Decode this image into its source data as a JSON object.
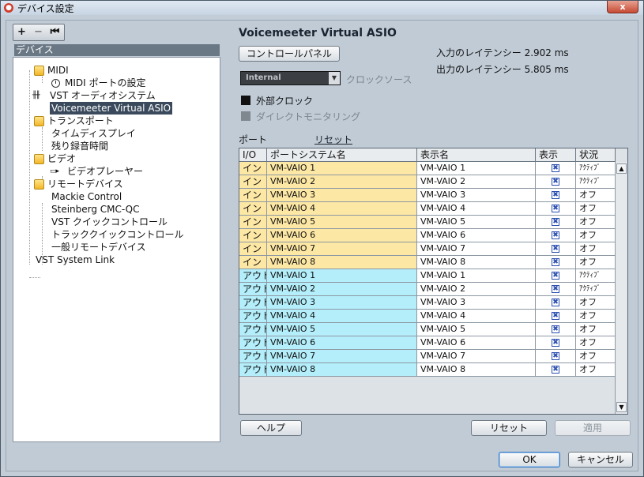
{
  "window": {
    "title": "デバイス設定",
    "close_label": "x"
  },
  "toolbar": {
    "add": "+",
    "remove": "−",
    "reset": "⏮"
  },
  "tree": {
    "header": "デバイス",
    "items": [
      {
        "label": "MIDI"
      },
      {
        "label": "MIDI ポートの設定"
      },
      {
        "label": "VST オーディオシステム"
      },
      {
        "label": "Voicemeeter Virtual ASIO"
      },
      {
        "label": "トランスポート"
      },
      {
        "label": "タイムディスプレイ"
      },
      {
        "label": "残り録音時間"
      },
      {
        "label": "ビデオ"
      },
      {
        "label": "ビデオプレーヤー"
      },
      {
        "label": "リモートデバイス"
      },
      {
        "label": "Mackie Control"
      },
      {
        "label": "Steinberg CMC-QC"
      },
      {
        "label": "VST クイックコントロール"
      },
      {
        "label": "トラッククイックコントロール"
      },
      {
        "label": "一般リモートデバイス"
      },
      {
        "label": "VST System Link"
      }
    ]
  },
  "panel": {
    "title": "Voicemeeter Virtual ASIO",
    "control_panel_button": "コントロールパネル",
    "input_latency": "入力のレイテンシー 2.902 ms",
    "output_latency": "出力のレイテンシー 5.805 ms",
    "clock_source_value": "Internal",
    "clock_source_label": "クロックソース",
    "external_clock_label": "外部クロック",
    "direct_monitoring_label": "ダイレクトモニタリング",
    "ports_label": "ポート",
    "reset_link": "リセット"
  },
  "table": {
    "columns": [
      "I/O",
      "ポートシステム名",
      "表示名",
      "表示",
      "状況"
    ],
    "rows": [
      {
        "io": "イン",
        "system": "VM-VAIO 1",
        "display": "VM-VAIO 1",
        "visible": "✖",
        "status": "ｱｸﾃｨﾌﾞ"
      },
      {
        "io": "イン",
        "system": "VM-VAIO 2",
        "display": "VM-VAIO 2",
        "visible": "✖",
        "status": "ｱｸﾃｨﾌﾞ"
      },
      {
        "io": "イン",
        "system": "VM-VAIO 3",
        "display": "VM-VAIO 3",
        "visible": "✖",
        "status": "オフ"
      },
      {
        "io": "イン",
        "system": "VM-VAIO 4",
        "display": "VM-VAIO 4",
        "visible": "✖",
        "status": "オフ"
      },
      {
        "io": "イン",
        "system": "VM-VAIO 5",
        "display": "VM-VAIO 5",
        "visible": "✖",
        "status": "オフ"
      },
      {
        "io": "イン",
        "system": "VM-VAIO 6",
        "display": "VM-VAIO 6",
        "visible": "✖",
        "status": "オフ"
      },
      {
        "io": "イン",
        "system": "VM-VAIO 7",
        "display": "VM-VAIO 7",
        "visible": "✖",
        "status": "オフ"
      },
      {
        "io": "イン",
        "system": "VM-VAIO 8",
        "display": "VM-VAIO 8",
        "visible": "✖",
        "status": "オフ"
      },
      {
        "io": "アウト",
        "system": "VM-VAIO 1",
        "display": "VM-VAIO 1",
        "visible": "✖",
        "status": "ｱｸﾃｨﾌﾞ"
      },
      {
        "io": "アウト",
        "system": "VM-VAIO 2",
        "display": "VM-VAIO 2",
        "visible": "✖",
        "status": "ｱｸﾃｨﾌﾞ"
      },
      {
        "io": "アウト",
        "system": "VM-VAIO 3",
        "display": "VM-VAIO 3",
        "visible": "✖",
        "status": "オフ"
      },
      {
        "io": "アウト",
        "system": "VM-VAIO 4",
        "display": "VM-VAIO 4",
        "visible": "✖",
        "status": "オフ"
      },
      {
        "io": "アウト",
        "system": "VM-VAIO 5",
        "display": "VM-VAIO 5",
        "visible": "✖",
        "status": "オフ"
      },
      {
        "io": "アウト",
        "system": "VM-VAIO 6",
        "display": "VM-VAIO 6",
        "visible": "✖",
        "status": "オフ"
      },
      {
        "io": "アウト",
        "system": "VM-VAIO 7",
        "display": "VM-VAIO 7",
        "visible": "✖",
        "status": "オフ"
      },
      {
        "io": "アウト",
        "system": "VM-VAIO 8",
        "display": "VM-VAIO 8",
        "visible": "✖",
        "status": "オフ"
      }
    ]
  },
  "buttons": {
    "help": "ヘルプ",
    "reset": "リセット",
    "apply": "適用",
    "ok": "OK",
    "cancel": "キャンセル"
  },
  "colors": {
    "in_row": "#fde7a4",
    "out_row": "#b3eefa",
    "selected": "#3a4a5c"
  }
}
